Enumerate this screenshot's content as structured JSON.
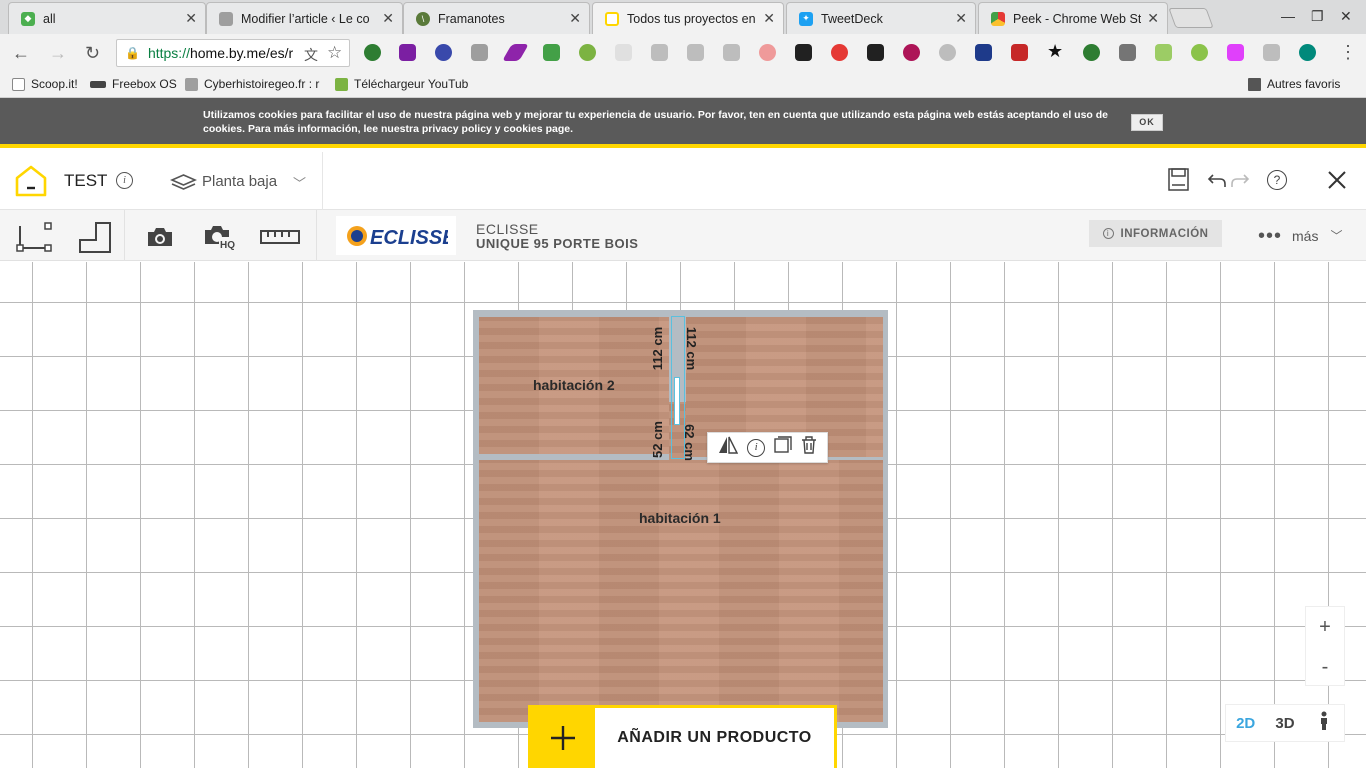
{
  "browser": {
    "tabs": [
      {
        "title": "all",
        "color": "#4caf50"
      },
      {
        "title": "Modifier l’article ‹ Le co",
        "color": "#9e9e9e"
      },
      {
        "title": "Framanotes",
        "color": "#5a7a3a"
      },
      {
        "title": "Todos tus proyectos en",
        "color": "#ffd600"
      },
      {
        "title": "TweetDeck",
        "color": "#1da1f2"
      },
      {
        "title": "Peek - Chrome Web Sto",
        "color": "#e53935"
      }
    ],
    "url_scheme": "https://",
    "url_rest": "home.by.me/es/r",
    "bookmarks": [
      "Scoop.it!",
      "Freebox OS",
      "Cyberhistoiregeo.fr : r",
      "Téléchargeur YouTub",
      "Autres favoris"
    ]
  },
  "cookie_banner": {
    "text": "Utilizamos cookies para facilitar el uso de nuestra página web y mejorar tu experiencia de usuario. Por favor, ten en cuenta que utilizando esta página web estás aceptando el uso de cookies. Para más información, lee nuestra privacy policy y cookies page.",
    "ok_label": "OK"
  },
  "header": {
    "project_name": "TEST",
    "floor_label": "Planta baja"
  },
  "product_bar": {
    "brand_logo": "ECLISSE",
    "brand": "ECLISSE",
    "product": "UNIQUE 95 PORTE BOIS",
    "info_label": "INFORMACIÓN",
    "more_label": "más"
  },
  "plan": {
    "room1": "habitación 1",
    "room2": "habitación 2",
    "dimensions": [
      "112 cm",
      "112 cm",
      "52 cm",
      "62 cm"
    ]
  },
  "controls": {
    "zoom_in": "+",
    "zoom_out": "-",
    "view_2d": "2D",
    "view_3d": "3D",
    "add_product": "AÑADIR UN PRODUCTO"
  },
  "colors": {
    "accent": "#ffd600",
    "floor": "#c4937a",
    "wall": "#b4bcc3",
    "active_view": "#3aa6df"
  }
}
